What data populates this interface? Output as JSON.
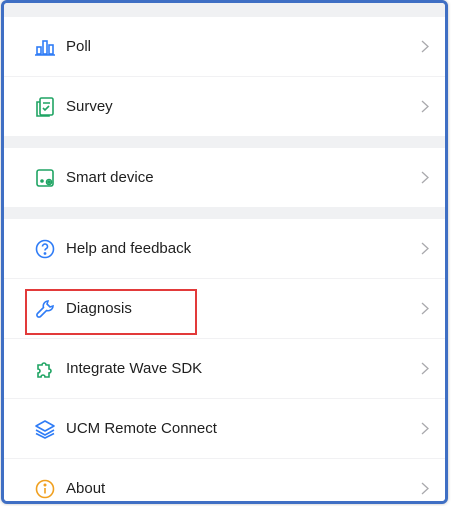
{
  "accent_color": "#2f7cf6",
  "highlight_color": "#e23a3a",
  "menu": {
    "groups": [
      {
        "items": [
          {
            "label": "Poll",
            "icon": "bar-chart-icon"
          },
          {
            "label": "Survey",
            "icon": "survey-form-icon"
          }
        ]
      },
      {
        "items": [
          {
            "label": "Smart device",
            "icon": "smart-device-icon"
          }
        ]
      },
      {
        "items": [
          {
            "label": "Help and feedback",
            "icon": "help-circle-icon"
          },
          {
            "label": "Diagnosis",
            "icon": "wrench-icon"
          },
          {
            "label": "Integrate Wave SDK",
            "icon": "puzzle-icon"
          },
          {
            "label": "UCM Remote Connect",
            "icon": "layers-icon"
          },
          {
            "label": "About",
            "icon": "info-circle-icon"
          }
        ]
      }
    ]
  }
}
